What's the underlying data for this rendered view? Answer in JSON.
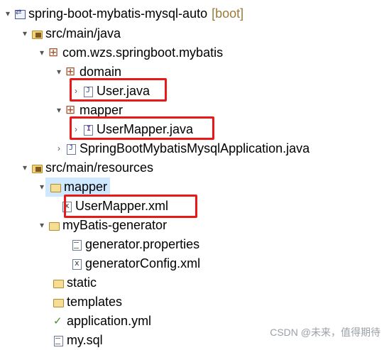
{
  "tree": {
    "project": {
      "name": "spring-boot-mybatis-mysql-auto",
      "tag": "[boot]"
    },
    "src_main_java": "src/main/java",
    "package": "com.wzs.springboot.mybatis",
    "domain": "domain",
    "user_java": "User.java",
    "mapper_pkg": "mapper",
    "user_mapper_java": "UserMapper.java",
    "app_java": "SpringBootMybatisMysqlApplication.java",
    "src_main_resources": "src/main/resources",
    "mapper_folder": "mapper",
    "user_mapper_xml": "UserMapper.xml",
    "mybatis_generator": "myBatis-generator",
    "generator_properties": "generator.properties",
    "generator_config": "generatorConfig.xml",
    "static": "static",
    "templates": "templates",
    "application_yml": "application.yml",
    "my_sql": "my.sql"
  },
  "watermark": "CSDN @未来，值得期待",
  "colors": {
    "highlight_border": "#e81919",
    "selection_bg": "#cde8ff",
    "boot_tag": "#9a7a3a"
  }
}
